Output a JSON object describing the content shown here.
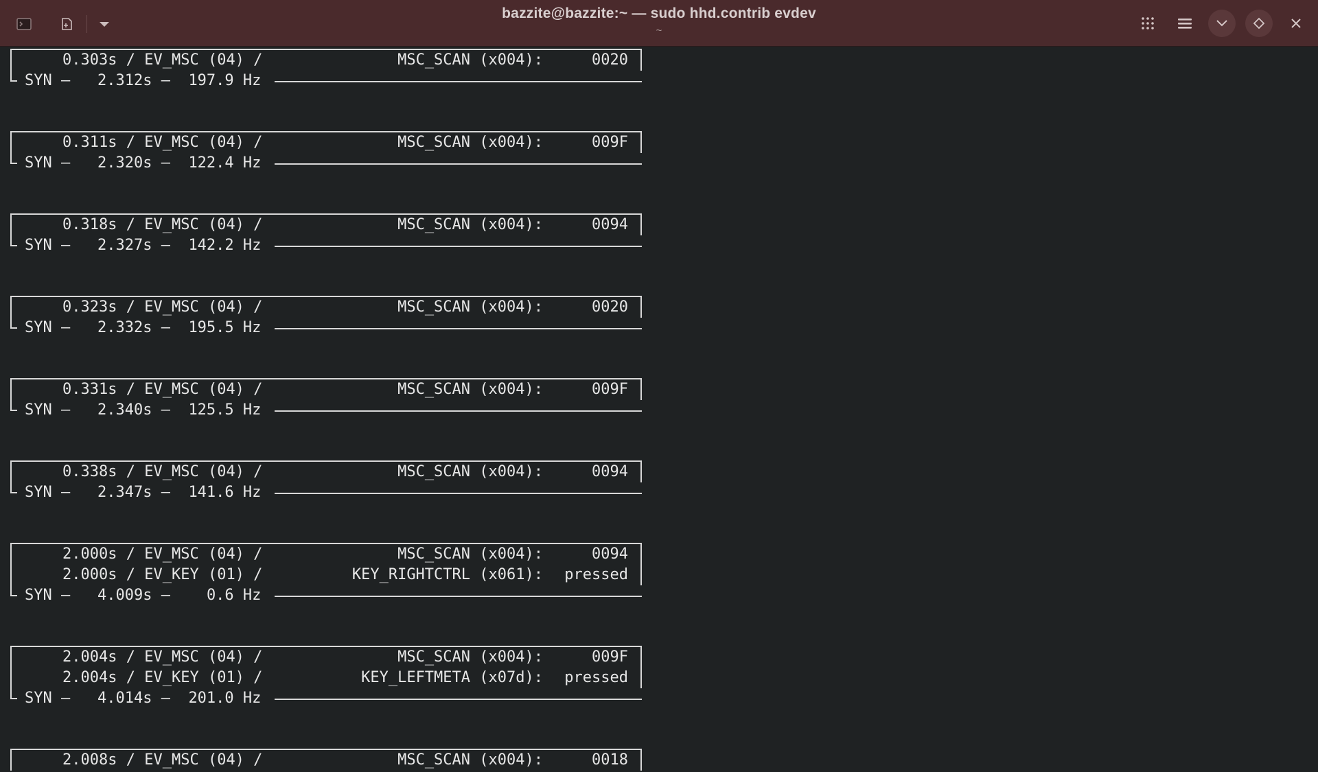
{
  "window": {
    "title": "bazzite@bazzite:~ — sudo hhd.contrib evdev",
    "subtitle": "~",
    "icons": {
      "terminal": "terminal-icon",
      "new_tab": "new-tab-icon",
      "dropdown": "chevron-down-icon",
      "grid": "grid-icon",
      "menu": "hamburger-menu-icon",
      "minimize": "chevron-down-icon",
      "maximize": "diamond-icon",
      "close": "close-icon"
    },
    "accent": "#4a2a2c"
  },
  "terminal": {
    "background": "#1f2223",
    "foreground": "#e6e6e6",
    "events": [
      {
        "rows": [
          {
            "time": "0.303s",
            "type": "EV_MSC (04)",
            "code": "MSC_SCAN (x004):",
            "value": "0020"
          }
        ],
        "syn": {
          "time": "2.312s",
          "rate": "197.9 Hz"
        }
      },
      {
        "rows": [
          {
            "time": "0.311s",
            "type": "EV_MSC (04)",
            "code": "MSC_SCAN (x004):",
            "value": "009F"
          }
        ],
        "syn": {
          "time": "2.320s",
          "rate": "122.4 Hz"
        }
      },
      {
        "rows": [
          {
            "time": "0.318s",
            "type": "EV_MSC (04)",
            "code": "MSC_SCAN (x004):",
            "value": "0094"
          }
        ],
        "syn": {
          "time": "2.327s",
          "rate": "142.2 Hz"
        }
      },
      {
        "rows": [
          {
            "time": "0.323s",
            "type": "EV_MSC (04)",
            "code": "MSC_SCAN (x004):",
            "value": "0020"
          }
        ],
        "syn": {
          "time": "2.332s",
          "rate": "195.5 Hz"
        }
      },
      {
        "rows": [
          {
            "time": "0.331s",
            "type": "EV_MSC (04)",
            "code": "MSC_SCAN (x004):",
            "value": "009F"
          }
        ],
        "syn": {
          "time": "2.340s",
          "rate": "125.5 Hz"
        }
      },
      {
        "rows": [
          {
            "time": "0.338s",
            "type": "EV_MSC (04)",
            "code": "MSC_SCAN (x004):",
            "value": "0094"
          }
        ],
        "syn": {
          "time": "2.347s",
          "rate": "141.6 Hz"
        }
      },
      {
        "rows": [
          {
            "time": "2.000s",
            "type": "EV_MSC (04)",
            "code": "MSC_SCAN (x004):",
            "value": "0094"
          },
          {
            "time": "2.000s",
            "type": "EV_KEY (01)",
            "code": "KEY_RIGHTCTRL (x061):",
            "value": "pressed"
          }
        ],
        "syn": {
          "time": "4.009s",
          "rate": "0.6 Hz"
        }
      },
      {
        "rows": [
          {
            "time": "2.004s",
            "type": "EV_MSC (04)",
            "code": "MSC_SCAN (x004):",
            "value": "009F"
          },
          {
            "time": "2.004s",
            "type": "EV_KEY (01)",
            "code": "KEY_LEFTMETA (x07d):",
            "value": "pressed"
          }
        ],
        "syn": {
          "time": "4.014s",
          "rate": "201.0 Hz"
        }
      },
      {
        "rows": [
          {
            "time": "2.008s",
            "type": "EV_MSC (04)",
            "code": "MSC_SCAN (x004):",
            "value": "0018"
          }
        ],
        "syn": null
      }
    ]
  }
}
